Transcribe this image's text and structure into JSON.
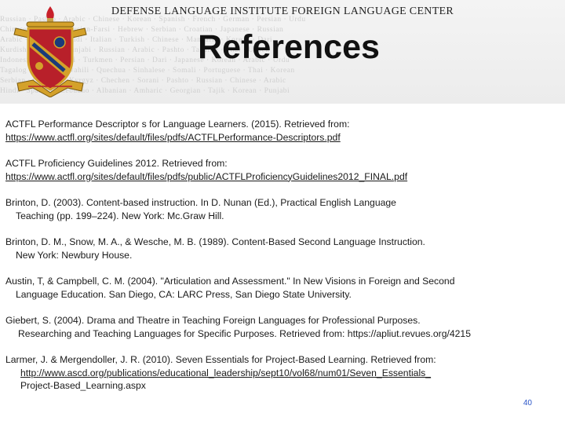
{
  "header": {
    "institute": "DEFENSE LANGUAGE INSTITUTE FOREIGN LANGUAGE CENTER",
    "title": "References",
    "background_words": [
      "Russian · Pashto · Arabic · Chinese · Korean · Spanish · French · German · Persian · Urdu",
      "Chinese · Korean · Persian-Farsi · Hebrew · Serbian · Croatian · Japanese · Russian",
      "Arabic · Spanish · Hindi · Italian · Turkish · Chinese · Mandarin · Korean · Dari",
      "Kurdish · Korean · Punjabi · Russian · Arabic · Pashto · Tagalog · Thai · Uzbek",
      "Indonesian · Kurmanji · Turkmen · Persian · Dari · Japanese · Korean · Arabic · Urdu",
      "Tagalog · Arabic · Swahili · Quechua · Sinhalese · Somali · Portuguese · Thai · Korean",
      "Serbian · Croatian · Kyrgyz · Chechen · Sorani · Pashto · Russian · Chinese · Arabic",
      "Hindi · Spanish · Cebuano · Albanian · Amharic · Georgian · Tajik · Korean · Punjabi"
    ]
  },
  "references": [
    {
      "lines": [
        "ACTFL Performance Descriptor s for Language Learners. (2015). Retrieved from:",
        "https://www.actfl.org/sites/default/files/pdfs/ACTFLPerformance-Descriptors.pdf"
      ]
    },
    {
      "lines": [
        "ACTFL Proficiency Guidelines 2012. Retrieved from:",
        "https://www.actfl.org/sites/default/files/pdfs/public/ACTFLProficiencyGuidelines2012_FINAL.pdf"
      ]
    },
    {
      "lines": [
        "Brinton, D. (2003). Content-based instruction. In D. Nunan (Ed.), Practical English Language",
        "Teaching (pp. 199–224). New York: Mc.Graw Hill."
      ]
    },
    {
      "lines": [
        "Brinton, D. M., Snow, M. A., & Wesche, M. B. (1989). Content-Based Second Language Instruction.",
        "New York: Newbury House."
      ]
    },
    {
      "lines": [
        "Austin, T, & Campbell, C. M. (2004). \"Articulation and Assessment.\" In New Visions in Foreign and Second",
        "Language Education. San Diego, CA: LARC Press, San Diego State University."
      ]
    },
    {
      "lines": [
        "Giebert, S. (2004). Drama and Theatre in Teaching Foreign Languages for Professional Purposes.",
        "Researching and Teaching Languages for Specific Purposes. Retrieved from: https://apliut.revues.org/4215"
      ]
    },
    {
      "lines": [
        "Larmer, J. & Mergendoller, J. R. (2010). Seven Essentials for Project-Based Learning. Retrieved from:",
        "http://www.ascd.org/publications/educational_leadership/sept10/vol68/num01/Seven_Essentials_",
        "Project-Based_Learning.aspx"
      ]
    }
  ],
  "page_number": "40",
  "colors": {
    "link": "#1a1a1a",
    "page_number": "#2a55c8",
    "crest_shield": "#b8202a",
    "crest_gold": "#d4a12a"
  }
}
